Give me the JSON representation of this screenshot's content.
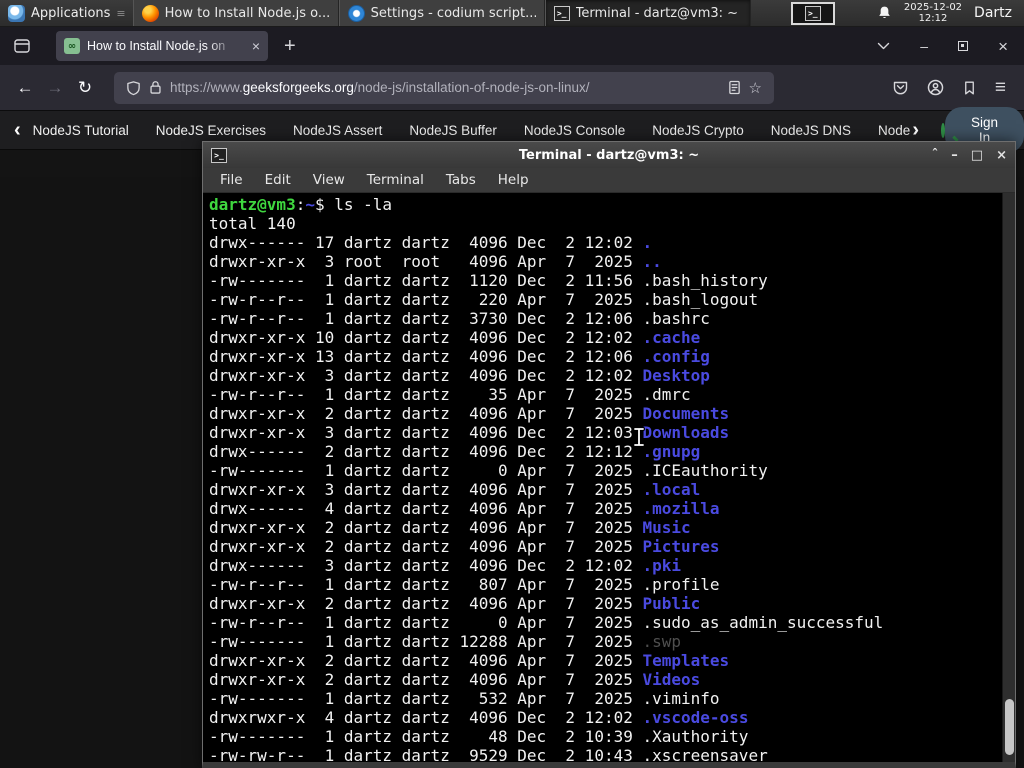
{
  "panel": {
    "applications_label": "Applications",
    "tasks": [
      {
        "icon": "firefox",
        "label": "How to Install Node.js o...",
        "active": false
      },
      {
        "icon": "codium",
        "label": "Settings - codium script...",
        "active": false
      },
      {
        "icon": "terminal",
        "label": "Terminal - dartz@vm3: ~",
        "active": true
      }
    ],
    "clock_date": "2025-12-02",
    "clock_time": "12:12",
    "user_label": "Dartz"
  },
  "browser": {
    "tab_title": "How to Install Node.js on",
    "tab_favicon_text": "GfG",
    "new_tab_label": "+",
    "url_prefix": "https://www.",
    "url_domain": "geeksforgeeks.org",
    "url_path": "/node-js/installation-of-node-js-on-linux/",
    "nav_links": [
      "NodeJS Tutorial",
      "NodeJS Exercises",
      "NodeJS Assert",
      "NodeJS Buffer",
      "NodeJS Console",
      "NodeJS Crypto",
      "NodeJS DNS",
      "Node"
    ],
    "sign_in_label": "Sign In",
    "gfg_green": "#2f8d46"
  },
  "terminal": {
    "title": "Terminal - dartz@vm3: ~",
    "menu": [
      "File",
      "Edit",
      "View",
      "Terminal",
      "Tabs",
      "Help"
    ],
    "colors": {
      "background": "#000000",
      "foreground": "#f2f2f2",
      "prompt_green": "#3fd83f",
      "dir_blue": "#4a4ae0",
      "dim": "#4f4f4f"
    },
    "lines": [
      [
        [
          "dartz@vm3",
          "g"
        ],
        [
          ":",
          "w"
        ],
        [
          "~",
          "b"
        ],
        [
          "$ ls -la",
          "w"
        ]
      ],
      [
        [
          "total 140",
          "w"
        ]
      ],
      [
        [
          "drwx------ 17 dartz dartz  4096 Dec  2 12:02 ",
          "w"
        ],
        [
          ".",
          "dir"
        ]
      ],
      [
        [
          "drwxr-xr-x  3 root  root   4096 Apr  7  2025 ",
          "w"
        ],
        [
          "..",
          "dir"
        ]
      ],
      [
        [
          "-rw-------  1 dartz dartz  1120 Dec  2 11:56 .bash_history",
          "w"
        ]
      ],
      [
        [
          "-rw-r--r--  1 dartz dartz   220 Apr  7  2025 .bash_logout",
          "w"
        ]
      ],
      [
        [
          "-rw-r--r--  1 dartz dartz  3730 Dec  2 12:06 .bashrc",
          "w"
        ]
      ],
      [
        [
          "drwxr-xr-x 10 dartz dartz  4096 Dec  2 12:02 ",
          "w"
        ],
        [
          ".cache",
          "dir"
        ]
      ],
      [
        [
          "drwxr-xr-x 13 dartz dartz  4096 Dec  2 12:06 ",
          "w"
        ],
        [
          ".config",
          "dir"
        ]
      ],
      [
        [
          "drwxr-xr-x  3 dartz dartz  4096 Dec  2 12:02 ",
          "w"
        ],
        [
          "Desktop",
          "dir"
        ]
      ],
      [
        [
          "-rw-r--r--  1 dartz dartz    35 Apr  7  2025 .dmrc",
          "w"
        ]
      ],
      [
        [
          "drwxr-xr-x  2 dartz dartz  4096 Apr  7  2025 ",
          "w"
        ],
        [
          "Documents",
          "dir"
        ]
      ],
      [
        [
          "drwxr-xr-x  3 dartz dartz  4096 Dec  2 12:03 ",
          "w"
        ],
        [
          "Downloads",
          "dir"
        ]
      ],
      [
        [
          "drwx------  2 dartz dartz  4096 Dec  2 12:12 ",
          "w"
        ],
        [
          ".gnupg",
          "dir"
        ]
      ],
      [
        [
          "-rw-------  1 dartz dartz     0 Apr  7  2025 .ICEauthority",
          "w"
        ]
      ],
      [
        [
          "drwxr-xr-x  3 dartz dartz  4096 Apr  7  2025 ",
          "w"
        ],
        [
          ".local",
          "dir"
        ]
      ],
      [
        [
          "drwx------  4 dartz dartz  4096 Apr  7  2025 ",
          "w"
        ],
        [
          ".mozilla",
          "dir"
        ]
      ],
      [
        [
          "drwxr-xr-x  2 dartz dartz  4096 Apr  7  2025 ",
          "w"
        ],
        [
          "Music",
          "dir"
        ]
      ],
      [
        [
          "drwxr-xr-x  2 dartz dartz  4096 Apr  7  2025 ",
          "w"
        ],
        [
          "Pictures",
          "dir"
        ]
      ],
      [
        [
          "drwx------  3 dartz dartz  4096 Dec  2 12:02 ",
          "w"
        ],
        [
          ".pki",
          "dir"
        ]
      ],
      [
        [
          "-rw-r--r--  1 dartz dartz   807 Apr  7  2025 .profile",
          "w"
        ]
      ],
      [
        [
          "drwxr-xr-x  2 dartz dartz  4096 Apr  7  2025 ",
          "w"
        ],
        [
          "Public",
          "dir"
        ]
      ],
      [
        [
          "-rw-r--r--  1 dartz dartz     0 Apr  7  2025 .sudo_as_admin_successful",
          "w"
        ]
      ],
      [
        [
          "-rw-------  1 dartz dartz 12288 Apr  7  2025 ",
          "w"
        ],
        [
          ".swp",
          "dim"
        ]
      ],
      [
        [
          "drwxr-xr-x  2 dartz dartz  4096 Apr  7  2025 ",
          "w"
        ],
        [
          "Templates",
          "dir"
        ]
      ],
      [
        [
          "drwxr-xr-x  2 dartz dartz  4096 Apr  7  2025 ",
          "w"
        ],
        [
          "Videos",
          "dir"
        ]
      ],
      [
        [
          "-rw-------  1 dartz dartz   532 Apr  7  2025 .viminfo",
          "w"
        ]
      ],
      [
        [
          "drwxrwxr-x  4 dartz dartz  4096 Dec  2 12:02 ",
          "w"
        ],
        [
          ".vscode-oss",
          "dir"
        ]
      ],
      [
        [
          "-rw-------  1 dartz dartz    48 Dec  2 10:39 .Xauthority",
          "w"
        ]
      ],
      [
        [
          "-rw-rw-r--  1 dartz dartz  9529 Dec  2 10:43 .xscreensaver",
          "w"
        ]
      ]
    ]
  }
}
